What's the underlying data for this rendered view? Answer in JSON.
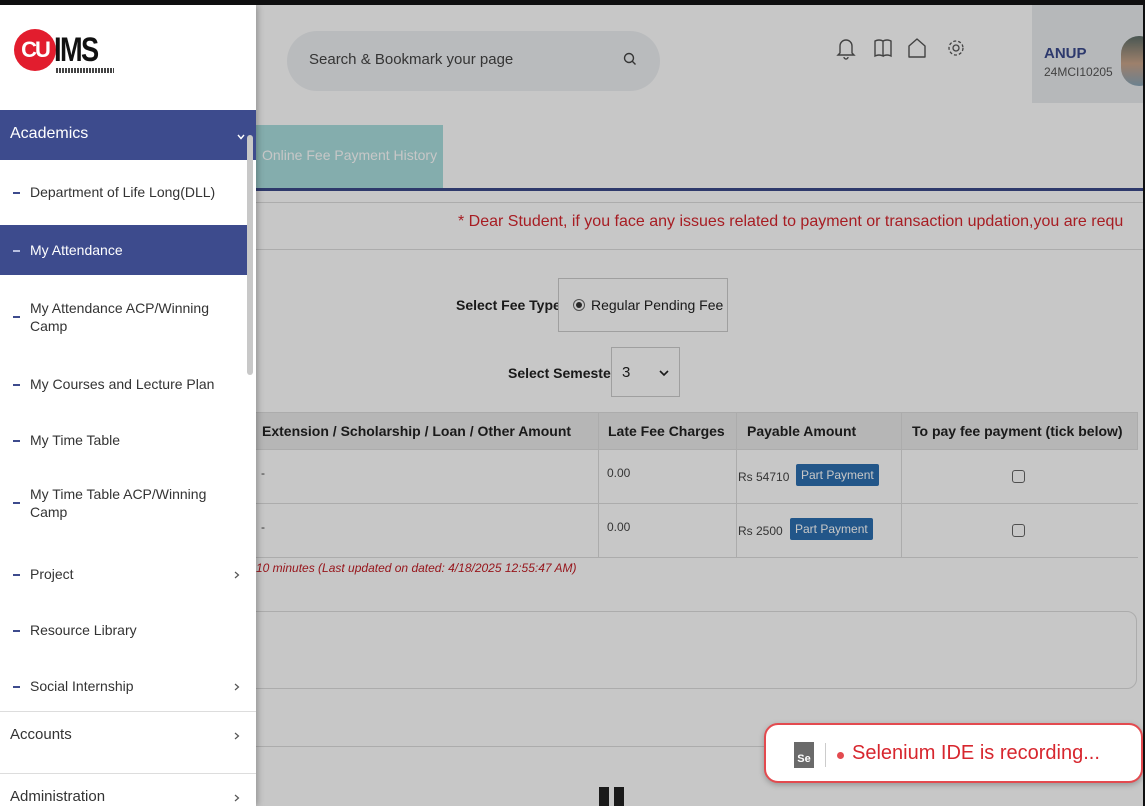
{
  "header": {
    "search_placeholder": "Search & Bookmark your page",
    "user_name": "ANUP",
    "user_id": "24MCI10205"
  },
  "logo": {
    "circle_text": "CU",
    "text": "IMS"
  },
  "tabs": {
    "history_label": "Online Fee Payment History"
  },
  "notice": "* Dear Student, if you face any issues related to payment or transaction updation,you are requ",
  "fee_form": {
    "fee_type_label": "Select Fee Type:",
    "fee_type_option": "Regular Pending Fee",
    "semester_label": "Select Semester:",
    "semester_value": "3"
  },
  "table": {
    "headers": [
      "Extension / Scholarship / Loan / Other Amount",
      "Late Fee Charges",
      "Payable Amount",
      "To pay fee payment (tick below)"
    ],
    "rows": [
      {
        "extension": "-",
        "late_fee": "0.00",
        "payable": "Rs 54710",
        "button": "Part Payment"
      },
      {
        "extension": "-",
        "late_fee": "0.00",
        "payable": "Rs 2500",
        "button": "Part Payment"
      }
    ]
  },
  "last_updated": "10 minutes (Last updated on dated: 4/18/2025 12:55:47 AM)",
  "sidebar": {
    "academics_label": "Academics",
    "items": [
      {
        "label": "Department of Life Long(DLL)"
      },
      {
        "label": "My Attendance"
      },
      {
        "label": "My Attendance ACP/Winning Camp"
      },
      {
        "label": "My Courses and Lecture Plan"
      },
      {
        "label": "My Time Table"
      },
      {
        "label": "My Time Table ACP/Winning Camp"
      },
      {
        "label": "Project"
      },
      {
        "label": "Resource Library"
      },
      {
        "label": "Social Internship"
      }
    ],
    "accounts_label": "Accounts",
    "administration_label": "Administration"
  },
  "selenium": {
    "logo_text": "Se",
    "text": "Selenium IDE is recording..."
  },
  "colors": {
    "primary": "#3d4b8d",
    "danger": "#d7262e",
    "tab": "#a9dede",
    "button": "#2c6fb0"
  }
}
